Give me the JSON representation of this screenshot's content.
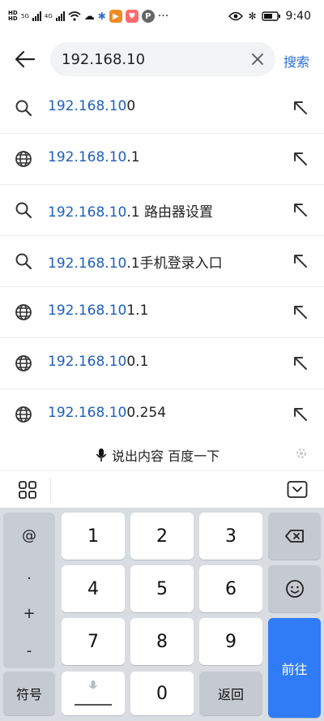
{
  "status_bar": {
    "left_labels": [
      "HD",
      "HD",
      "5G",
      "4G"
    ],
    "time": "9:40"
  },
  "search": {
    "query": "192.168.10",
    "submit_label": "搜索"
  },
  "suggestions": [
    {
      "icon": "search-icon",
      "highlight": "192.168.10",
      "rest": "0"
    },
    {
      "icon": "globe-icon",
      "highlight": "192.168.10",
      "rest": ".1"
    },
    {
      "icon": "search-icon",
      "highlight": "192.168.10",
      "rest": ".1 路由器设置"
    },
    {
      "icon": "search-icon",
      "highlight": "192.168.10",
      "rest": ".1手机登录入口"
    },
    {
      "icon": "globe-icon",
      "highlight": "192.168.10",
      "rest": "1.1"
    },
    {
      "icon": "globe-icon",
      "highlight": "192.168.10",
      "rest": "0.1"
    },
    {
      "icon": "globe-icon",
      "highlight": "192.168.10",
      "rest": "0.254"
    }
  ],
  "voice": {
    "label": "说出内容 百度一下"
  },
  "keyboard": {
    "symbols": [
      "@",
      ".",
      "+",
      "-"
    ],
    "digits": [
      "1",
      "2",
      "3",
      "4",
      "5",
      "6",
      "7",
      "8",
      "9"
    ],
    "zero": "0",
    "symbol_key": "符号",
    "return_key": "返回",
    "enter_key": "前往",
    "accent_color": "#2f7cf6"
  }
}
